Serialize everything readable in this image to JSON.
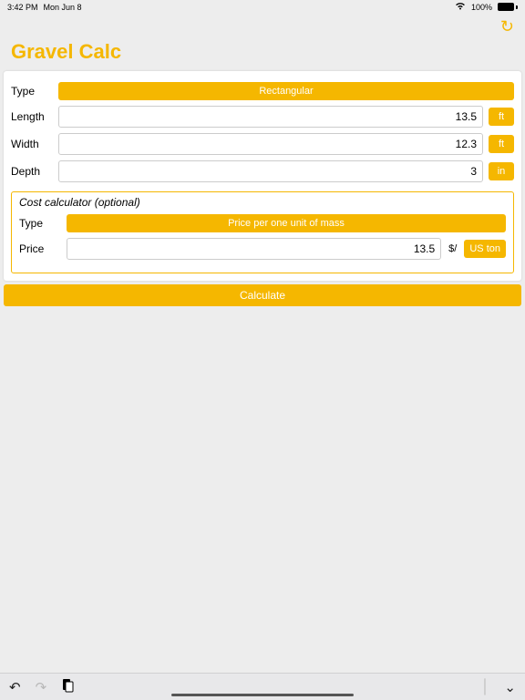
{
  "statusbar": {
    "time": "3:42 PM",
    "date": "Mon Jun 8",
    "battery": "100%"
  },
  "title": "Gravel Calc",
  "form": {
    "type_label": "Type",
    "shape": "Rectangular",
    "length_label": "Length",
    "length_value": "13.5",
    "length_unit": "ft",
    "width_label": "Width",
    "width_value": "12.3",
    "width_unit": "ft",
    "depth_label": "Depth",
    "depth_value": "3",
    "depth_unit": "in"
  },
  "cost": {
    "section_title": "Cost calculator (optional)",
    "type_label": "Type",
    "price_type": "Price per one unit of mass",
    "price_label": "Price",
    "price_value": "13.5",
    "price_suffix": "$/",
    "price_unit": "US ton"
  },
  "calculate_label": "Calculate"
}
